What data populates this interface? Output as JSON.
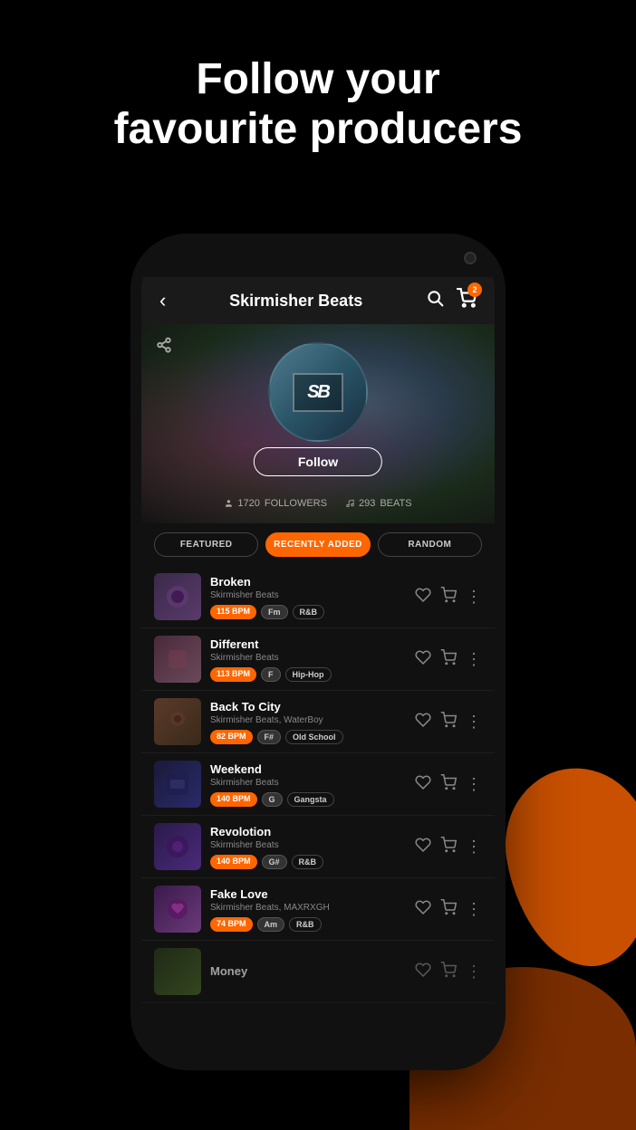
{
  "page": {
    "header": {
      "line1": "Follow your",
      "line2": "favourite producers"
    }
  },
  "phone": {
    "nav": {
      "back_label": "‹",
      "title": "Skirmisher Beats",
      "search_icon": "🔍",
      "cart_icon": "🛒",
      "cart_badge": "2"
    },
    "profile": {
      "share_icon": "share",
      "avatar_text": "SB",
      "follow_label": "Follow",
      "stats": {
        "followers_icon": "👤",
        "followers_count": "1720",
        "followers_label": "FOLLOWERS",
        "beats_icon": "≡",
        "beats_count": "293",
        "beats_label": "BEATS"
      }
    },
    "filters": [
      {
        "label": "FEATURED",
        "active": false
      },
      {
        "label": "RECENTLY ADDED",
        "active": true
      },
      {
        "label": "RANDOM",
        "active": false
      }
    ],
    "tracks": [
      {
        "title": "Broken",
        "artist": "Skirmisher Beats",
        "bpm": "115 BPM",
        "key": "Fm",
        "genre": "R&B",
        "thumb_class": "thumb-broken"
      },
      {
        "title": "Different",
        "artist": "Skirmisher Beats",
        "bpm": "113 BPM",
        "key": "F",
        "genre": "Hip-Hop",
        "thumb_class": "thumb-different"
      },
      {
        "title": "Back To City",
        "artist": "Skirmisher Beats, WaterBoy",
        "bpm": "82 BPM",
        "key": "F#",
        "genre": "Old School",
        "thumb_class": "thumb-backtocity"
      },
      {
        "title": "Weekend",
        "artist": "Skirmisher Beats",
        "bpm": "140 BPM",
        "key": "G",
        "genre": "Gangsta",
        "thumb_class": "thumb-weekend"
      },
      {
        "title": "Revolotion",
        "artist": "Skirmisher Beats",
        "bpm": "140 BPM",
        "key": "G#",
        "genre": "R&B",
        "thumb_class": "thumb-revolotion"
      },
      {
        "title": "Fake Love",
        "artist": "Skirmisher Beats, MAXRXGH",
        "bpm": "74 BPM",
        "key": "Am",
        "genre": "R&B",
        "thumb_class": "thumb-fakelove"
      }
    ]
  }
}
